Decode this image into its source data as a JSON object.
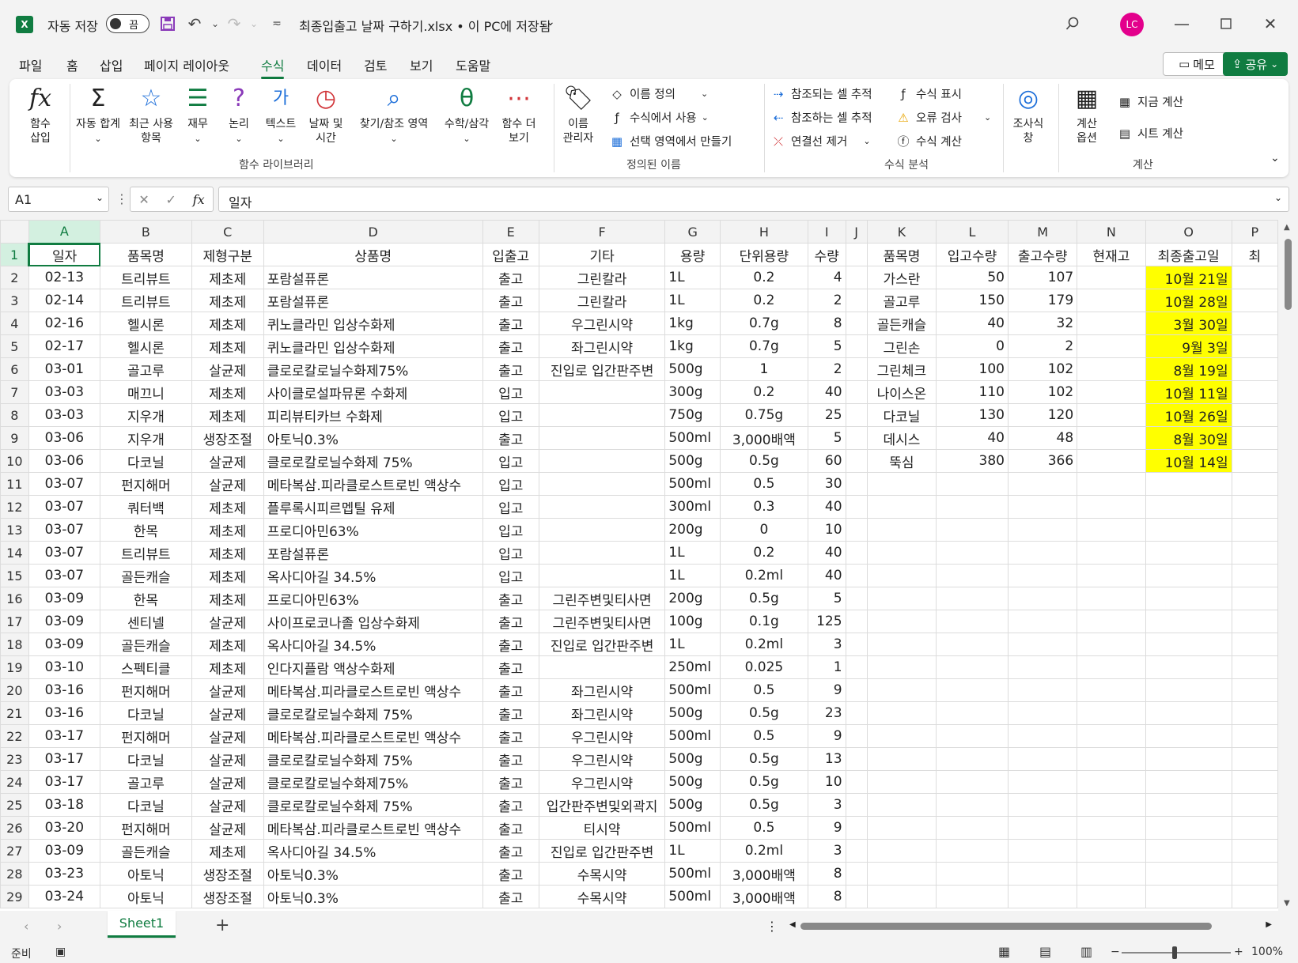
{
  "titlebar": {
    "autosave_label": "자동 저장",
    "autosave_state": "끔",
    "doc_title": "최종입출고 날짜 구하기.xlsx • 이 PC에 저장됨",
    "avatar_initials": "LC"
  },
  "tabs": [
    "파일",
    "홈",
    "삽입",
    "페이지 레이아웃",
    "수식",
    "데이터",
    "검토",
    "보기",
    "도움말"
  ],
  "active_tab": "수식",
  "memo_label": "메모",
  "share_label": "공유",
  "ribbon": {
    "insert_function": "함수\n삽입",
    "library": {
      "autosum": "자동 합계",
      "recent": "최근 사용\n항목",
      "financial": "재무",
      "logical": "논리",
      "text": "텍스트",
      "datetime": "날짜 및\n시간",
      "lookup": "찾기/참조 영역",
      "math": "수학/삼각",
      "more": "함수 더\n보기",
      "label": "함수 라이브러리"
    },
    "names": {
      "manager": "이름\n관리자",
      "define": "이름 정의",
      "use_in_formula": "수식에서 사용",
      "create_from_selection": "선택 영역에서 만들기",
      "label": "정의된 이름"
    },
    "audit": {
      "trace_precedents": "참조되는 셀 추적",
      "trace_dependents": "참조하는 셀 추적",
      "remove_arrows": "연결선 제거",
      "show_formulas": "수식 표시",
      "error_check": "오류 검사",
      "evaluate": "수식 계산",
      "watch": "조사식\n창",
      "label": "수식 분석"
    },
    "calc": {
      "options": "계산\n옵션",
      "calc_now": "지금 계산",
      "calc_sheet": "시트 계산",
      "label": "계산"
    }
  },
  "formula_bar": {
    "name_box": "A1",
    "formula": "일자"
  },
  "columns": [
    "A",
    "B",
    "C",
    "D",
    "E",
    "F",
    "G",
    "H",
    "I",
    "J",
    "K",
    "L",
    "M",
    "N",
    "O",
    "P"
  ],
  "headers": [
    "일자",
    "품목명",
    "제형구분",
    "상품명",
    "입출고",
    "기타",
    "용량",
    "단위용량",
    "수량",
    "",
    "품목명",
    "입고수량",
    "출고수량",
    "현재고",
    "최종출고일",
    "최"
  ],
  "rows": [
    [
      "02-13",
      "트리뷰트",
      "제초제",
      "포람설퓨론",
      "출고",
      "그린칼라",
      "1L",
      "0.2",
      "4"
    ],
    [
      "02-14",
      "트리뷰트",
      "제초제",
      "포람설퓨론",
      "출고",
      "그린칼라",
      "1L",
      "0.2",
      "2"
    ],
    [
      "02-16",
      "헬시론",
      "제초제",
      "퀴노클라민 입상수화제",
      "출고",
      "우그린시약",
      "1kg",
      "0.7g",
      "8"
    ],
    [
      "02-17",
      "헬시론",
      "제초제",
      "퀴노클라민 입상수화제",
      "출고",
      "좌그린시약",
      "1kg",
      "0.7g",
      "5"
    ],
    [
      "03-01",
      "골고루",
      "살균제",
      "클로로칼로닐수화제75%",
      "출고",
      "진입로 입간판주변",
      "500g",
      "1",
      "2"
    ],
    [
      "03-03",
      "매끄니",
      "제초제",
      "사이클로설파뮤론 수화제",
      "입고",
      "",
      "300g",
      "0.2",
      "40"
    ],
    [
      "03-03",
      "지우개",
      "제초제",
      "피리뷰티카브 수화제",
      "입고",
      "",
      "750g",
      "0.75g",
      "25"
    ],
    [
      "03-06",
      "지우개",
      "생장조절",
      "아토닉0.3%",
      "출고",
      "",
      "500ml",
      "3,000배액",
      "5"
    ],
    [
      "03-06",
      "다코닐",
      "살균제",
      "클로로칼로닐수화제 75%",
      "입고",
      "",
      "500g",
      "0.5g",
      "60"
    ],
    [
      "03-07",
      "펀지해머",
      "살균제",
      "메타복삼.피라클로스트로빈 액상수",
      "입고",
      "",
      "500ml",
      "0.5",
      "30"
    ],
    [
      "03-07",
      "쿼터백",
      "제초제",
      "플루록시피르멥틸 유제",
      "입고",
      "",
      "300ml",
      "0.3",
      "40"
    ],
    [
      "03-07",
      "한목",
      "제초제",
      "프로디아민63%",
      "입고",
      "",
      "200g",
      "0",
      "10"
    ],
    [
      "03-07",
      "트리뷰트",
      "제초제",
      "포람설퓨론",
      "입고",
      "",
      "1L",
      "0.2",
      "40"
    ],
    [
      "03-07",
      "골든캐슬",
      "제초제",
      "옥사디아길 34.5%",
      "입고",
      "",
      "1L",
      "0.2ml",
      "40"
    ],
    [
      "03-09",
      "한목",
      "제초제",
      "프로디아민63%",
      "출고",
      "그린주변및티사면",
      "200g",
      "0.5g",
      "5"
    ],
    [
      "03-09",
      "센티넬",
      "살균제",
      "사이프로코나졸 입상수화제",
      "출고",
      "그린주변및티사면",
      "100g",
      "0.1g",
      "125"
    ],
    [
      "03-09",
      "골든캐슬",
      "제초제",
      "옥사디아길 34.5%",
      "출고",
      "진입로 입간판주변",
      "1L",
      "0.2ml",
      "3"
    ],
    [
      "03-10",
      "스펙티클",
      "제초제",
      "인다지플람 액상수화제",
      "출고",
      "",
      "250ml",
      "0.025",
      "1"
    ],
    [
      "03-16",
      "펀지해머",
      "살균제",
      "메타복삼.피라클로스트로빈 액상수",
      "출고",
      "좌그린시약",
      "500ml",
      "0.5",
      "9"
    ],
    [
      "03-16",
      "다코닐",
      "살균제",
      "클로로칼로닐수화제 75%",
      "출고",
      "좌그린시약",
      "500g",
      "0.5g",
      "23"
    ],
    [
      "03-17",
      "펀지해머",
      "살균제",
      "메타복삼.피라클로스트로빈 액상수",
      "출고",
      "우그린시약",
      "500ml",
      "0.5",
      "9"
    ],
    [
      "03-17",
      "다코닐",
      "살균제",
      "클로로칼로닐수화제 75%",
      "출고",
      "우그린시약",
      "500g",
      "0.5g",
      "13"
    ],
    [
      "03-17",
      "골고루",
      "살균제",
      "클로로칼로닐수화제75%",
      "출고",
      "우그린시약",
      "500g",
      "0.5g",
      "10"
    ],
    [
      "03-18",
      "다코닐",
      "살균제",
      "클로로칼로닐수화제 75%",
      "출고",
      "입간판주변및외곽지",
      "500g",
      "0.5g",
      "3"
    ],
    [
      "03-20",
      "펀지해머",
      "살균제",
      "메타복삼.피라클로스트로빈 액상수",
      "출고",
      "티시약",
      "500ml",
      "0.5",
      "9"
    ],
    [
      "03-09",
      "골든캐슬",
      "제초제",
      "옥사디아길 34.5%",
      "출고",
      "진입로 입간판주변",
      "1L",
      "0.2ml",
      "3"
    ],
    [
      "03-23",
      "아토닉",
      "생장조절",
      "아토닉0.3%",
      "출고",
      "수목시약",
      "500ml",
      "3,000배액",
      "8"
    ],
    [
      "03-24",
      "아토닉",
      "생장조절",
      "아토닉0.3%",
      "출고",
      "수목시약",
      "500ml",
      "3,000배액",
      "8"
    ]
  ],
  "summary": [
    [
      "가스란",
      "50",
      "107",
      "",
      "10월 21일"
    ],
    [
      "골고루",
      "150",
      "179",
      "",
      "10월 28일"
    ],
    [
      "골든캐슬",
      "40",
      "32",
      "",
      "3월 30일"
    ],
    [
      "그린손",
      "0",
      "2",
      "",
      "9월 3일"
    ],
    [
      "그린체크",
      "100",
      "102",
      "",
      "8월 19일"
    ],
    [
      "나이스온",
      "110",
      "102",
      "",
      "10월 11일"
    ],
    [
      "다코닐",
      "130",
      "120",
      "",
      "10월 26일"
    ],
    [
      "데시스",
      "40",
      "48",
      "",
      "8월 30일"
    ],
    [
      "뚝심",
      "380",
      "366",
      "",
      "10월 14일"
    ]
  ],
  "sheet_tab": "Sheet1",
  "status": {
    "ready": "준비",
    "zoom": "100%"
  },
  "colors": {
    "accent": "#107c41",
    "highlight": "#ffff00"
  }
}
